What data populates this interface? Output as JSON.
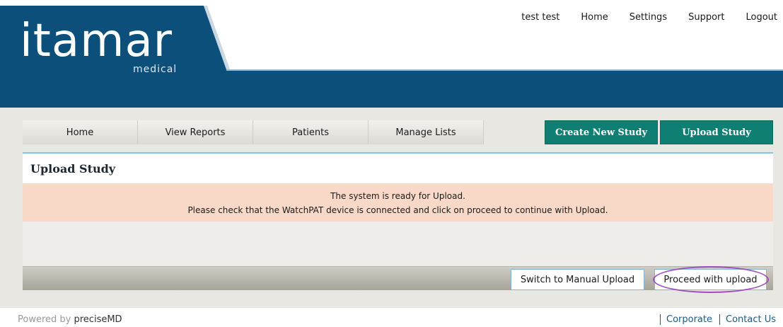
{
  "brand": {
    "logo_text": "itamar",
    "logo_sub": "medical"
  },
  "topnav": {
    "user": "test test",
    "home": "Home",
    "settings": "Settings",
    "support": "Support",
    "logout": "Logout"
  },
  "tabs": [
    "Home",
    "View Reports",
    "Patients",
    "Manage Lists"
  ],
  "actions": {
    "create": "Create New Study",
    "upload": "Upload Study"
  },
  "panel": {
    "title": "Upload Study",
    "notice_line1": "The system is ready for Upload.",
    "notice_line2": "Please check that the WatchPAT device is connected and click on proceed to continue with Upload.",
    "manual_button": "Switch to Manual Upload",
    "proceed_button": "Proceed with upload"
  },
  "footer": {
    "powered_prefix": "Powered by",
    "powered_brand": "preciseMD",
    "corporate": "Corporate",
    "contact": "Contact Us"
  },
  "colors": {
    "header_blue": "#0b4f7a",
    "accent_teal": "#0f7f73",
    "notice_bg": "#f8d9c8",
    "highlight_ring": "#9b4fc0"
  }
}
